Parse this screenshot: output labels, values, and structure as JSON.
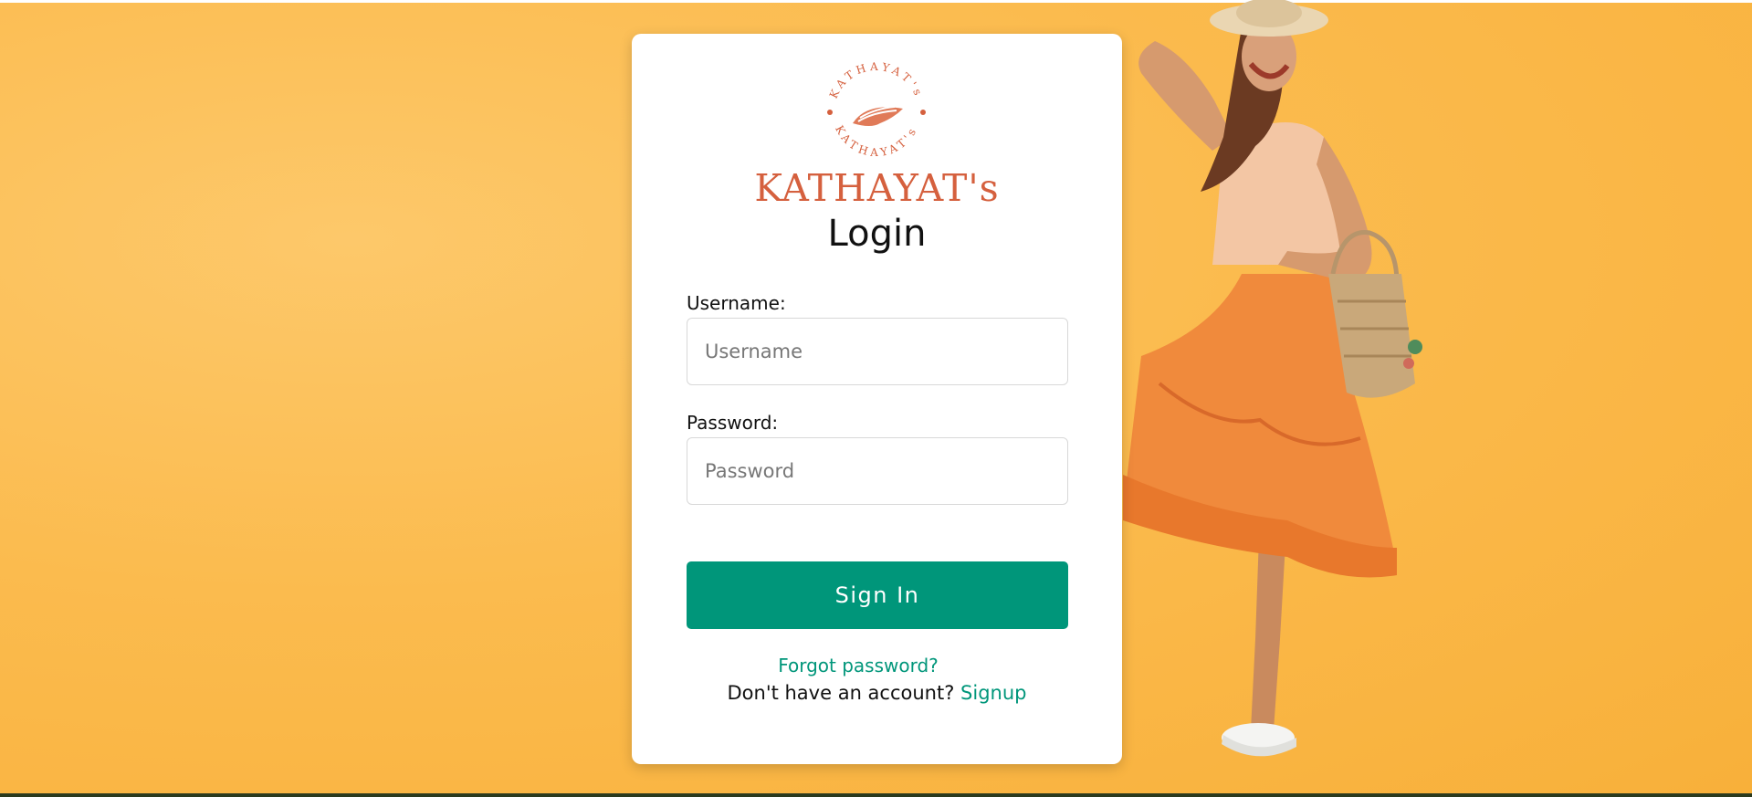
{
  "brand": {
    "name": "KATHAYAT's",
    "emblem_text": "KATHAYAT's",
    "emblem_color": "#d5603e"
  },
  "login": {
    "title": "Login",
    "username_label": "Username:",
    "username_placeholder": "Username",
    "username_value": "",
    "password_label": "Password:",
    "password_placeholder": "Password",
    "password_value": "",
    "signin_label": "Sign In",
    "forgot_label": "Forgot password?",
    "no_account_text": "Don't have an account?",
    "signup_label": "Signup"
  },
  "colors": {
    "background": "#fbbb4e",
    "accent": "#00967a",
    "brand": "#d5603e"
  },
  "icons": {
    "logo": "feather-emblem-icon"
  }
}
